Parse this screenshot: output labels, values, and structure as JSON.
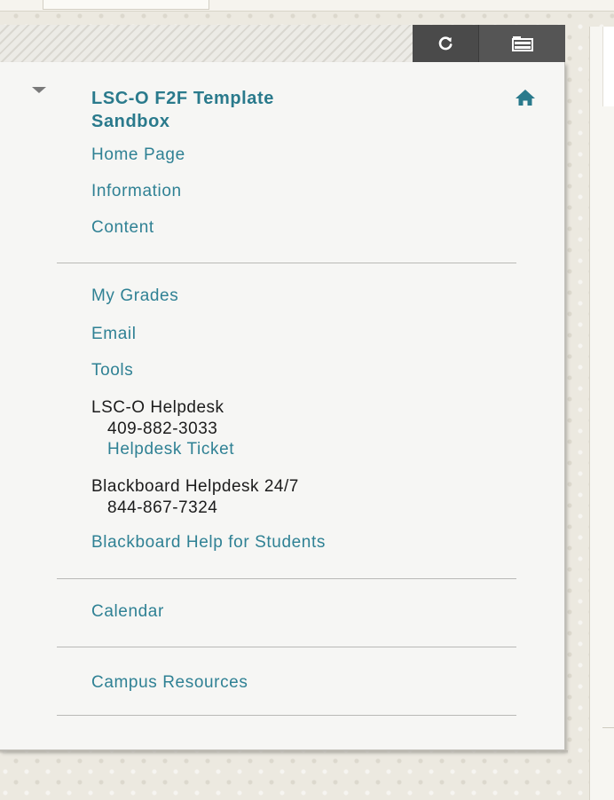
{
  "course": {
    "title_line1": "LSC-O F2F Template",
    "title_line2": "Sandbox"
  },
  "header": {
    "refresh_icon": "refresh-icon",
    "folder_icon": "folder-view-icon",
    "home_icon": "home-icon"
  },
  "menu": {
    "group1": [
      "Home Page",
      "Information",
      "Content"
    ],
    "group2": {
      "my_grades": "My Grades",
      "email": "Email",
      "tools": "Tools",
      "helpdesk_title": "LSC-O Helpdesk",
      "helpdesk_phone": "409-882-3033",
      "helpdesk_ticket": "Helpdesk Ticket",
      "bb_helpdesk_title": "Blackboard Helpdesk 24/7",
      "bb_helpdesk_phone": "844-867-7324",
      "bb_help_students": "Blackboard Help for Students"
    },
    "calendar": "Calendar",
    "campus_resources": "Campus Resources"
  },
  "colors": {
    "link": "#2f8194",
    "header_button": "#4a4a4a",
    "panel_bg": "#f6f6f4"
  }
}
